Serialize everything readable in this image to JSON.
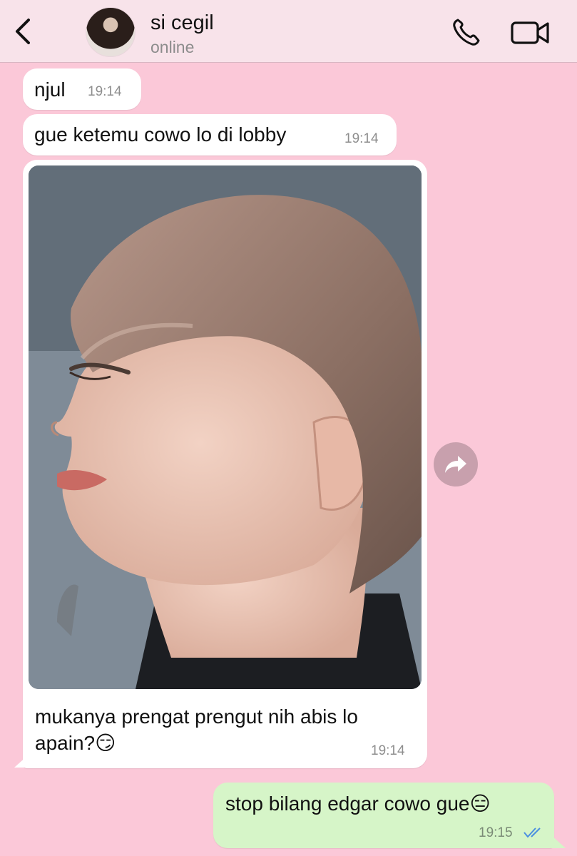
{
  "header": {
    "contact_name": "si cegil",
    "status": "online",
    "icons": [
      "back-chevron-icon",
      "phone-icon",
      "video-camera-icon"
    ]
  },
  "messages": [
    {
      "text": "njul",
      "time": "19:14",
      "direction": "incoming"
    },
    {
      "text": "gue ketemu cowo lo di lobby",
      "time": "19:14",
      "direction": "incoming"
    },
    {
      "caption_line1": "mukanya prengat prengut nih abis lo",
      "caption_line2": "apain?😏",
      "time": "19:14",
      "direction": "incoming",
      "has_photo": true
    },
    {
      "text": "stop bilang edgar cowo gue😑",
      "time": "19:15",
      "direction": "outgoing",
      "read": true
    }
  ],
  "colors": {
    "background": "#fbc8d8",
    "header": "#f8e3ea",
    "incoming_bubble": "#ffffff",
    "outgoing_bubble": "#d6f5c8",
    "read_ticks": "#4a8fe0"
  }
}
